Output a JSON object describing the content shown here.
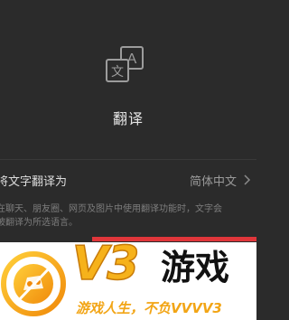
{
  "feature": {
    "icon": "translate-icon",
    "icon_glyph_a": "A",
    "icon_glyph_b": "文",
    "title": "翻译"
  },
  "setting": {
    "label": "将文字翻译为",
    "value": "简体中文",
    "chevron": "chevron-right-icon"
  },
  "description": {
    "line1": "在聊天、朋友圈、网页及图片中使用翻译功能时，文字会",
    "line2": "被翻译为所选语言。"
  },
  "watermark": {
    "brand_latin": "V3",
    "brand_cn": "游戏",
    "slogan": "游戏人生，不负VVVV3",
    "logo_icon": "game-pad-circle-icon"
  },
  "colors": {
    "background": "#2b2b2b",
    "accent_red": "#e0363a",
    "brand_orange": "#f6b21b"
  }
}
